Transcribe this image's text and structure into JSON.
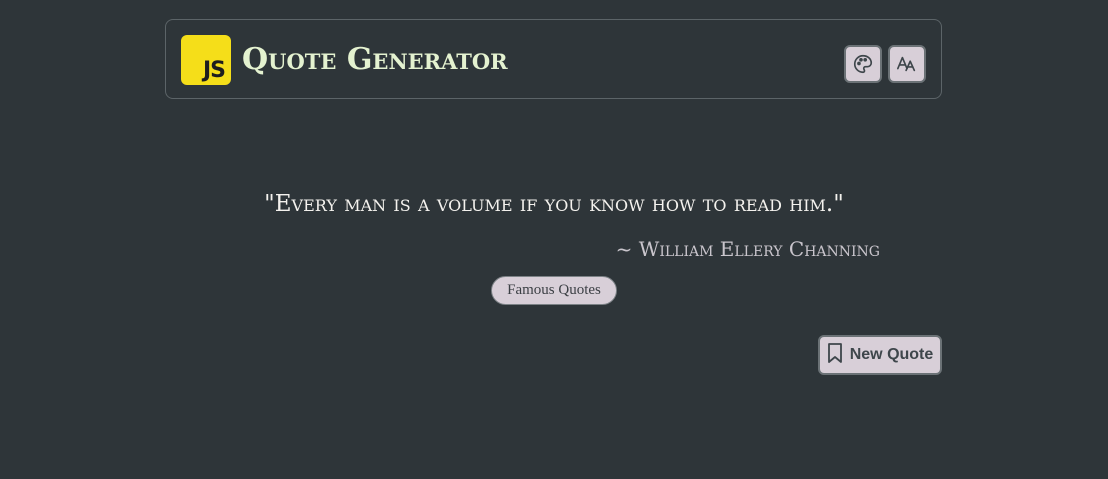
{
  "header": {
    "logo_text": "JS",
    "title": "Quote Generator",
    "buttons": [
      {
        "icon": "palette-icon"
      },
      {
        "icon": "font-size-icon"
      }
    ]
  },
  "quote": {
    "text": "\"Every man is a volume if you know how to read him.\"",
    "author": "~ William Ellery Channing",
    "tag": "Famous Quotes"
  },
  "actions": {
    "new_quote_label": "New Quote",
    "new_quote_icon": "bookmark-icon"
  },
  "colors": {
    "background": "#2e3539",
    "title": "#e4f2d0",
    "logo": "#f5de19",
    "button_bg": "#d8cfd8"
  }
}
